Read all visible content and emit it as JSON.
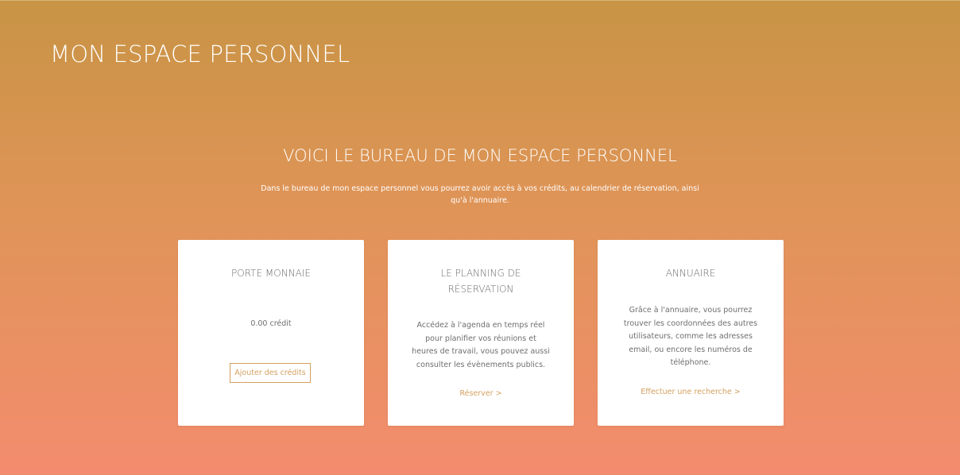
{
  "page": {
    "title": "MON ESPACE PERSONNEL"
  },
  "section": {
    "title": "VOICI LE BUREAU DE MON ESPACE PERSONNEL",
    "intro": "Dans le bureau de mon espace personnel vous pourrez avoir accès à vos crédits, au calendrier de réservation, ainsi qu'à l'annuaire."
  },
  "cards": {
    "wallet": {
      "title": "PORTE MONNAIE",
      "balance": "0.00 crédit",
      "button_label": "Ajouter des crédits"
    },
    "planning": {
      "title": "LE PLANNING DE RÉSERVATION",
      "text": "Accédez à l'agenda en temps réel pour planifier vos réunions et heures de travail, vous pouvez aussi consulter les évènements publics.",
      "link_label": "Réserver >"
    },
    "directory": {
      "title": "ANNUAIRE",
      "text": "Grâce à l'annuaire, vous pourrez trouver les coordonnées des autres utilisateurs, comme les adresses email, ou encore les numéros de téléphone.",
      "link_label": "Effectuer une recherche >"
    }
  },
  "colors": {
    "gradient_top": "#c89445",
    "gradient_bottom": "#f38c6e",
    "accent": "#d4a060",
    "card_background": "#ffffff"
  }
}
